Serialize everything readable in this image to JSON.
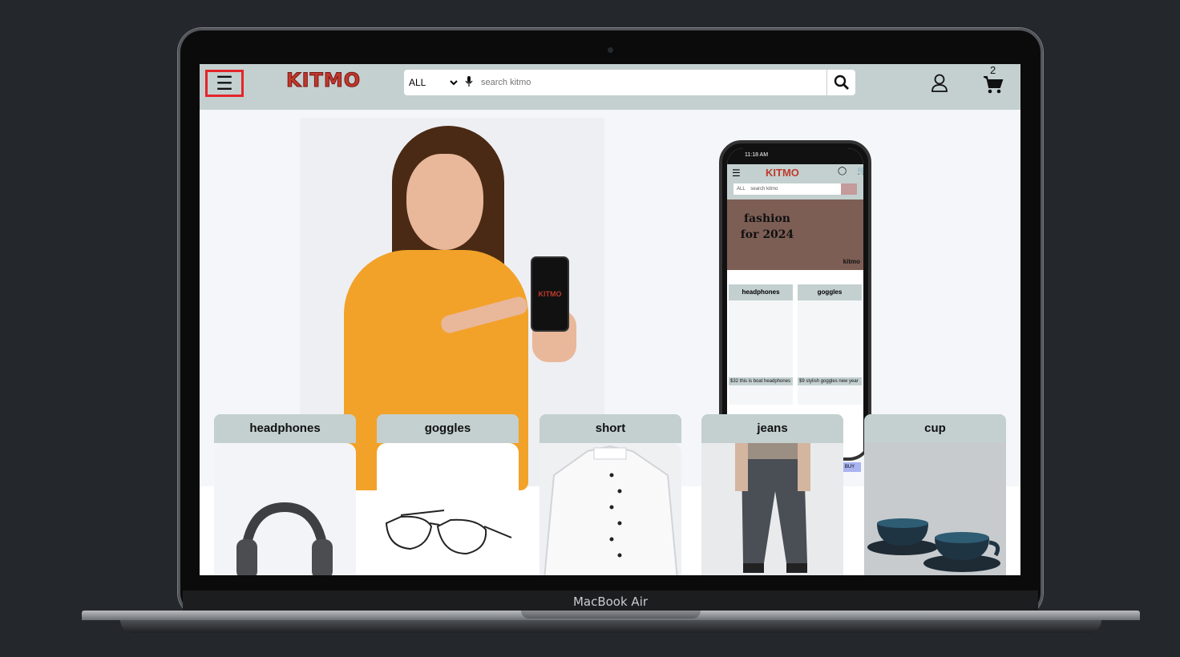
{
  "navbar": {
    "logo": "KITMO",
    "search": {
      "category": "ALL",
      "placeholder": "search kitmo"
    },
    "cart_count": "2"
  },
  "hero": {
    "model_phone_logo": "KITMO",
    "phone_mockup": {
      "status_time": "11:18 AM",
      "logo": "KITMO",
      "search_category": "ALL",
      "search_placeholder": "search kitmo",
      "banner_text": "fashion for 2024",
      "banner_brand": "kitmo",
      "cards": [
        {
          "title": "headphones",
          "price": "$32",
          "desc": "this is boat headphones"
        },
        {
          "title": "goggles",
          "price": "$9",
          "desc": "stylish goggles new year"
        }
      ],
      "buy_label": "BUY"
    }
  },
  "products": [
    {
      "title": "headphones"
    },
    {
      "title": "goggles"
    },
    {
      "title": "short"
    },
    {
      "title": "jeans"
    },
    {
      "title": "cup"
    }
  ],
  "device": {
    "label": "MacBook Air"
  }
}
